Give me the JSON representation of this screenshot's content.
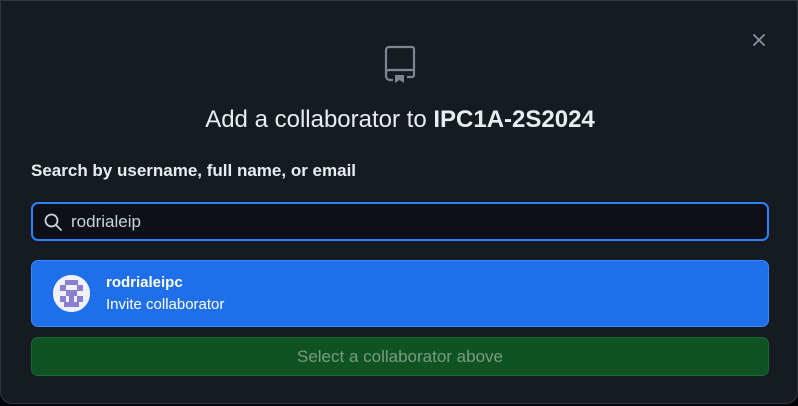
{
  "dialog": {
    "title_prefix": "Add a collaborator to ",
    "repo_name": "IPC1A-2S2024",
    "close_icon": "close-icon",
    "header_icon": "repo-icon"
  },
  "search": {
    "label": "Search by username, full name, or email",
    "value": "rodrialeip",
    "icon": "search-icon"
  },
  "results": [
    {
      "username": "rodrialeipc",
      "action": "Invite collaborator",
      "avatar": "identicon-avatar"
    }
  ],
  "footer": {
    "select_label": "Select a collaborator above"
  },
  "colors": {
    "background": "#161b22",
    "accent_blue": "#1f6feb",
    "focus_border": "#2f81f7",
    "disabled_green": "#0f5323",
    "avatar_purple": "#8a7fd3"
  }
}
